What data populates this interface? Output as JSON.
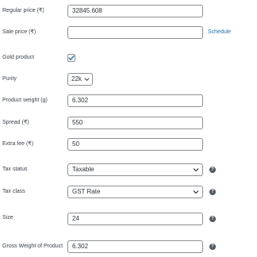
{
  "fields": {
    "regular_price": {
      "label": "Regular price (₹)",
      "value": "32845.608"
    },
    "sale_price": {
      "label": "Sale price (₹)",
      "value": "",
      "link": "Schedule"
    },
    "gold_product": {
      "label": "Gold product",
      "checked": true
    },
    "purity": {
      "label": "Purity",
      "value": "22k"
    },
    "product_weight": {
      "label": "Product weight (g)",
      "value": "6.302"
    },
    "spread": {
      "label": "Spread (₹)",
      "value": "550"
    },
    "extra_fee": {
      "label": "Extra fee (₹)",
      "value": "50"
    },
    "tax_status": {
      "label": "Tax status",
      "value": "Taxable"
    },
    "tax_class": {
      "label": "Tax class",
      "value": "GST Rate"
    },
    "size": {
      "label": "Size",
      "value": "24"
    },
    "gross_weight": {
      "label": "Gross Weight of Product",
      "value": "6.302"
    }
  },
  "help_icon_glyph": "?",
  "colors": {
    "link": "#2271b1",
    "checkmark": "#2271b1",
    "border": "#8c8f94",
    "help_bg": "#50575e"
  }
}
